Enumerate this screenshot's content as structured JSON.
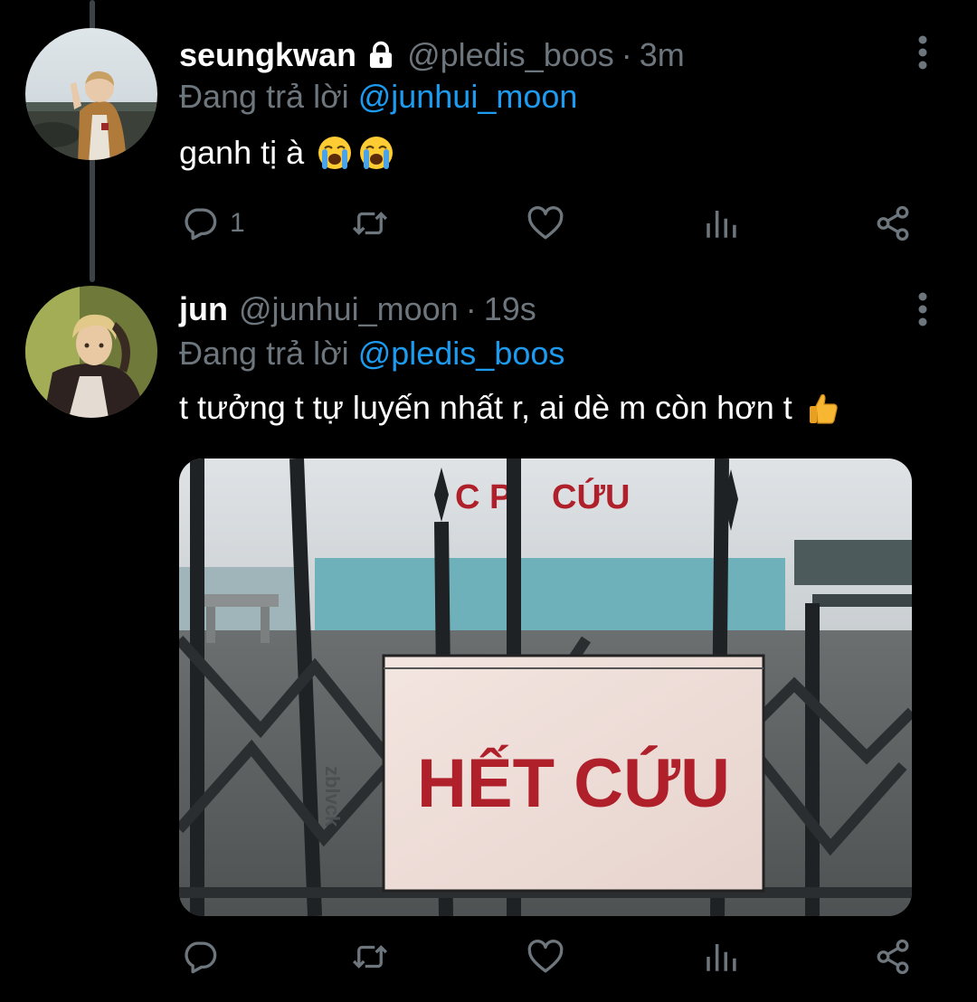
{
  "tweets": [
    {
      "display_name": "seungkwan",
      "handle": "@pledis_boos",
      "separator": "·",
      "time": "3m",
      "replying_to_prefix": "Đang trả lời",
      "replying_to_handle": "@junhui_moon",
      "text": "ganh tị à",
      "emojis": [
        "loudly-crying-face",
        "loudly-crying-face"
      ],
      "reply_count": "1",
      "protected": true
    },
    {
      "display_name": "jun",
      "handle": "@junhui_moon",
      "separator": "·",
      "time": "19s",
      "replying_to_prefix": "Đang trả lời",
      "replying_to_handle": "@pledis_boos",
      "text": "t tưởng t tự luyến nhất r, ai dè m còn hơn t",
      "emojis": [
        "thumbs-up"
      ],
      "reply_count": ""
    }
  ],
  "media": {
    "sign_text": "HẾT CỨU",
    "wall_text_left": "C  P",
    "wall_text_right": "CỨU",
    "side_text": "zblvck"
  },
  "colors": {
    "background": "#000000",
    "secondary_text": "#6e767d",
    "link": "#1d9bf0",
    "thread_line": "#3d4247",
    "sign_red": "#b0202a"
  },
  "icons": {
    "actions": [
      "reply-icon",
      "retweet-icon",
      "like-icon",
      "analytics-icon",
      "share-icon"
    ],
    "more": "more-vertical-icon",
    "lock": "lock-icon"
  }
}
